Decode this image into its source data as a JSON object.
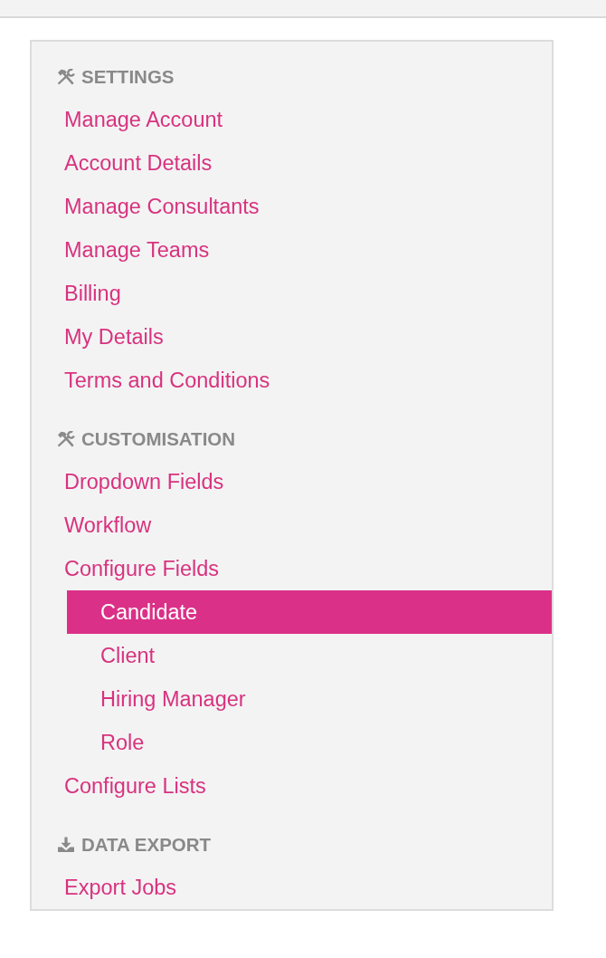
{
  "sections": [
    {
      "kind": "tools",
      "heading": "SETTINGS",
      "items": [
        {
          "label": "Manage Account",
          "selected": false
        },
        {
          "label": "Account Details",
          "selected": false
        },
        {
          "label": "Manage Consultants",
          "selected": false
        },
        {
          "label": "Manage Teams",
          "selected": false
        },
        {
          "label": "Billing",
          "selected": false
        },
        {
          "label": "My Details",
          "selected": false
        },
        {
          "label": "Terms and Conditions",
          "selected": false
        }
      ]
    },
    {
      "kind": "tools",
      "heading": "CUSTOMISATION",
      "items": [
        {
          "label": "Dropdown Fields",
          "selected": false
        },
        {
          "label": "Workflow",
          "selected": false
        },
        {
          "label": "Configure Fields",
          "selected": false,
          "children": [
            {
              "label": "Candidate",
              "selected": true
            },
            {
              "label": "Client",
              "selected": false
            },
            {
              "label": "Hiring Manager",
              "selected": false
            },
            {
              "label": "Role",
              "selected": false
            }
          ]
        },
        {
          "label": "Configure Lists",
          "selected": false
        }
      ]
    },
    {
      "kind": "export",
      "heading": "DATA EXPORT",
      "items": [
        {
          "label": "Export Jobs",
          "selected": false
        }
      ]
    }
  ]
}
